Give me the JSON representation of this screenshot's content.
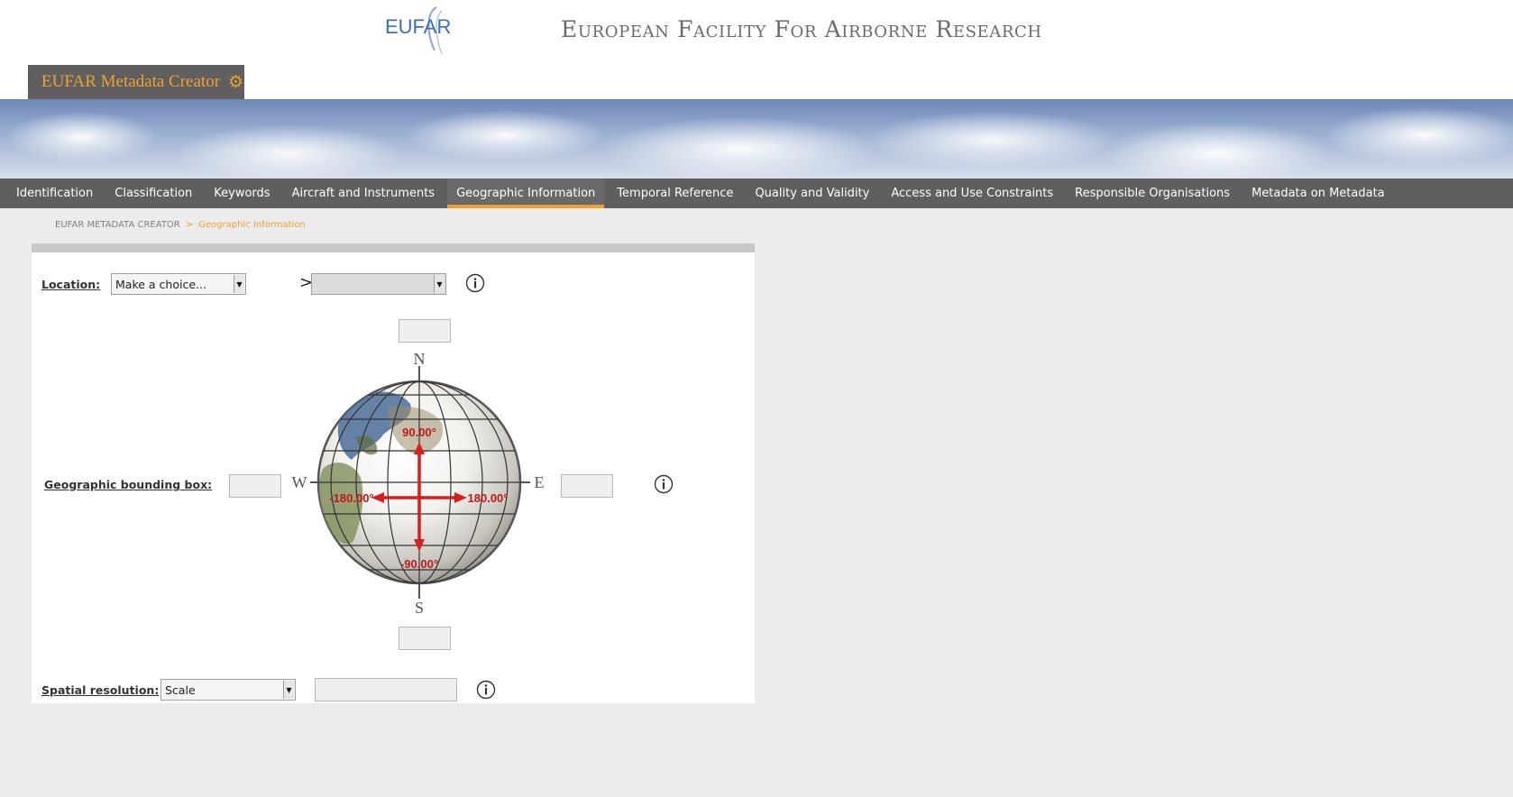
{
  "header": {
    "logo_text": "EUFAR",
    "site_title": "European Facility For Airborne Research",
    "app_title": "EUFAR Metadata Creator"
  },
  "nav": {
    "items": [
      {
        "label": "Identification"
      },
      {
        "label": "Classification"
      },
      {
        "label": "Keywords"
      },
      {
        "label": "Aircraft and Instruments"
      },
      {
        "label": "Geographic Information",
        "active": true
      },
      {
        "label": "Temporal Reference"
      },
      {
        "label": "Quality and Validity"
      },
      {
        "label": "Access and Use Constraints"
      },
      {
        "label": "Responsible Organisations"
      },
      {
        "label": "Metadata on Metadata"
      }
    ]
  },
  "breadcrumb": {
    "root": "EUFAR METADATA CREATOR",
    "separator": ">",
    "current": "Geographic Information"
  },
  "form": {
    "location": {
      "label": "Location:",
      "select_value": "Make a choice...",
      "separator": ">>",
      "sub_select_value": ""
    },
    "bbox": {
      "label": "Geographic bounding box:",
      "north": "",
      "south": "",
      "west": "",
      "east": "",
      "compass": {
        "n": "N",
        "s": "S",
        "w": "W",
        "e": "E"
      },
      "limits": {
        "north": "90.00°",
        "south": "-90.00°",
        "west": "-180.00°",
        "east": "180.00°"
      }
    },
    "spatial_resolution": {
      "label": "Spatial resolution:",
      "select_value": "Scale",
      "value": ""
    }
  },
  "colors": {
    "accent": "#f0a030",
    "nav_bg": "#5f5f5f",
    "arrow_red": "#d42020",
    "page_bg": "#ececec"
  }
}
